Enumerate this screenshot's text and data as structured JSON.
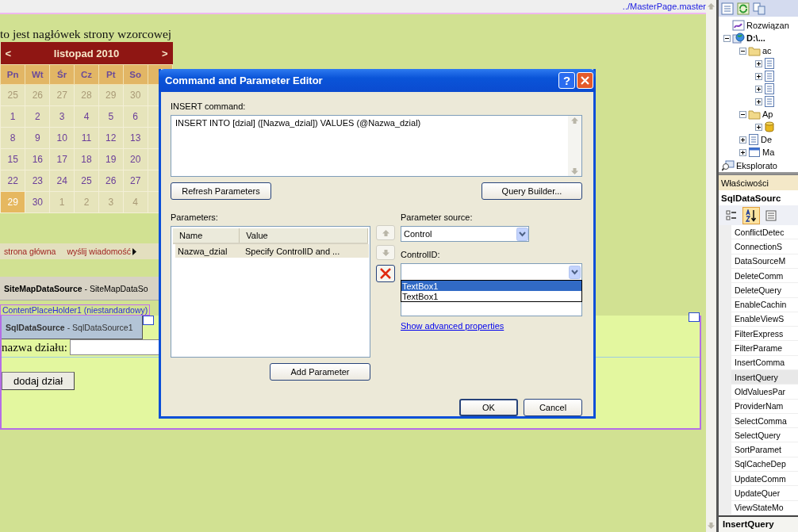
{
  "designer": {
    "master_path": "../MasterPage.master",
    "header": "to jest nagłówek strony wzorcowej",
    "calendar": {
      "prev": "<",
      "title": "listopad 2010",
      "next": ">",
      "weekdays": [
        "Pn",
        "Wt",
        "Śr",
        "Cz",
        "Pt",
        "So"
      ],
      "weeks": [
        [
          {
            "day": "25",
            "other_month": true,
            "selected": false
          },
          {
            "day": "26",
            "other_month": true,
            "selected": false
          },
          {
            "day": "27",
            "other_month": true,
            "selected": false
          },
          {
            "day": "28",
            "other_month": true,
            "selected": false
          },
          {
            "day": "29",
            "other_month": true,
            "selected": false
          },
          {
            "day": "30",
            "other_month": true,
            "selected": false
          }
        ],
        [
          {
            "day": "1",
            "other_month": false,
            "selected": false
          },
          {
            "day": "2",
            "other_month": false,
            "selected": false
          },
          {
            "day": "3",
            "other_month": false,
            "selected": false
          },
          {
            "day": "4",
            "other_month": false,
            "selected": false
          },
          {
            "day": "5",
            "other_month": false,
            "selected": false
          },
          {
            "day": "6",
            "other_month": false,
            "selected": false
          }
        ],
        [
          {
            "day": "8",
            "other_month": false,
            "selected": false
          },
          {
            "day": "9",
            "other_month": false,
            "selected": false
          },
          {
            "day": "10",
            "other_month": false,
            "selected": false
          },
          {
            "day": "11",
            "other_month": false,
            "selected": false
          },
          {
            "day": "12",
            "other_month": false,
            "selected": false
          },
          {
            "day": "13",
            "other_month": false,
            "selected": false
          }
        ],
        [
          {
            "day": "15",
            "other_month": false,
            "selected": false
          },
          {
            "day": "16",
            "other_month": false,
            "selected": false
          },
          {
            "day": "17",
            "other_month": false,
            "selected": false
          },
          {
            "day": "18",
            "other_month": false,
            "selected": false
          },
          {
            "day": "19",
            "other_month": false,
            "selected": false
          },
          {
            "day": "20",
            "other_month": false,
            "selected": false
          }
        ],
        [
          {
            "day": "22",
            "other_month": false,
            "selected": false
          },
          {
            "day": "23",
            "other_month": false,
            "selected": false
          },
          {
            "day": "24",
            "other_month": false,
            "selected": false
          },
          {
            "day": "25",
            "other_month": false,
            "selected": false
          },
          {
            "day": "26",
            "other_month": false,
            "selected": false
          },
          {
            "day": "27",
            "other_month": false,
            "selected": false
          }
        ],
        [
          {
            "day": "29",
            "other_month": false,
            "selected": true
          },
          {
            "day": "30",
            "other_month": false,
            "selected": false
          },
          {
            "day": "1",
            "other_month": true,
            "selected": false
          },
          {
            "day": "2",
            "other_month": true,
            "selected": false
          },
          {
            "day": "3",
            "other_month": true,
            "selected": false
          },
          {
            "day": "4",
            "other_month": true,
            "selected": false
          }
        ]
      ]
    },
    "menu": [
      "strona główna",
      "wyślij wiadomość"
    ],
    "sitemap_source": {
      "type": "SiteMapDataSource",
      "separator": "-",
      "id": "SiteMapDataSo"
    },
    "placeholder_label": "ContentPlaceHolder1 (niestandardowy)",
    "sql_source": {
      "type": "SqlDataSource",
      "separator": "-",
      "id": "SqlDataSource1"
    },
    "field_label": "nazwa działu:",
    "submit": "dodaj dział"
  },
  "dialog": {
    "title": "Command and Parameter Editor",
    "help": "?",
    "command_label": "INSERT command:",
    "command_text": "INSERT INTO [dzial] ([Nazwa_dzial]) VALUES (@Nazwa_dzial)",
    "refresh": "Refresh Parameters",
    "query_builder": "Query Builder...",
    "parameters_label": "Parameters:",
    "columns": [
      "Name",
      "Value"
    ],
    "parameters": [
      {
        "name": "Nazwa_dzial",
        "value": "Specify ControlID and ...",
        "selected": true
      }
    ],
    "add": "Add Parameter",
    "move_up_disabled": true,
    "move_down_disabled": true,
    "source_label": "Parameter source:",
    "source_value": "Control",
    "control_label": "ControlID:",
    "control_options": [
      {
        "text": "TextBox1",
        "selected": true
      },
      {
        "text": "TextBox1",
        "selected": false
      }
    ],
    "advanced_link": "Show advanced properties",
    "ok": "OK",
    "cancel": "Cancel"
  },
  "solution_explorer": {
    "tree": [
      {
        "label": "Rozwiązan",
        "kind": "solution"
      },
      {
        "label": "D:\\...",
        "kind": "project",
        "expanded": true,
        "children": [
          {
            "label": "ac",
            "kind": "folder",
            "expanded": true,
            "children": [
              {
                "kind": "page",
                "expanded": false
              },
              {
                "kind": "page",
                "expanded": false
              },
              {
                "kind": "page",
                "expanded": false
              },
              {
                "kind": "page",
                "expanded": false
              }
            ]
          },
          {
            "label": "Ap",
            "kind": "folder",
            "expanded": true,
            "children": [
              {
                "kind": "database",
                "expanded": false
              }
            ]
          },
          {
            "label": "De",
            "kind": "page",
            "expanded": false
          },
          {
            "label": "Ma",
            "kind": "window",
            "expanded": false
          }
        ]
      }
    ],
    "tab": "Eksplorato"
  },
  "properties": {
    "title": "Właściwości",
    "object": "SqlDataSourc",
    "alphabetical": true,
    "items": [
      {
        "name": "ConflictDetec",
        "selected": false
      },
      {
        "name": "ConnectionS",
        "selected": false
      },
      {
        "name": "DataSourceM",
        "selected": false
      },
      {
        "name": "DeleteComm",
        "selected": false
      },
      {
        "name": "DeleteQuery",
        "selected": false
      },
      {
        "name": "EnableCachin",
        "selected": false
      },
      {
        "name": "EnableViewS",
        "selected": false
      },
      {
        "name": "FilterExpress",
        "selected": false
      },
      {
        "name": "FilterParame",
        "selected": false
      },
      {
        "name": "InsertComma",
        "selected": false
      },
      {
        "name": "InsertQuery",
        "selected": true
      },
      {
        "name": "OldValuesPar",
        "selected": false
      },
      {
        "name": "ProviderNam",
        "selected": false
      },
      {
        "name": "SelectComma",
        "selected": false
      },
      {
        "name": "SelectQuery",
        "selected": false
      },
      {
        "name": "SortParamet",
        "selected": false
      },
      {
        "name": "SqlCacheDep",
        "selected": false
      },
      {
        "name": "UpdateComm",
        "selected": false
      },
      {
        "name": "UpdateQuer",
        "selected": false
      },
      {
        "name": "ViewStateMo",
        "selected": false
      }
    ],
    "description_title": "InsertQuery"
  }
}
